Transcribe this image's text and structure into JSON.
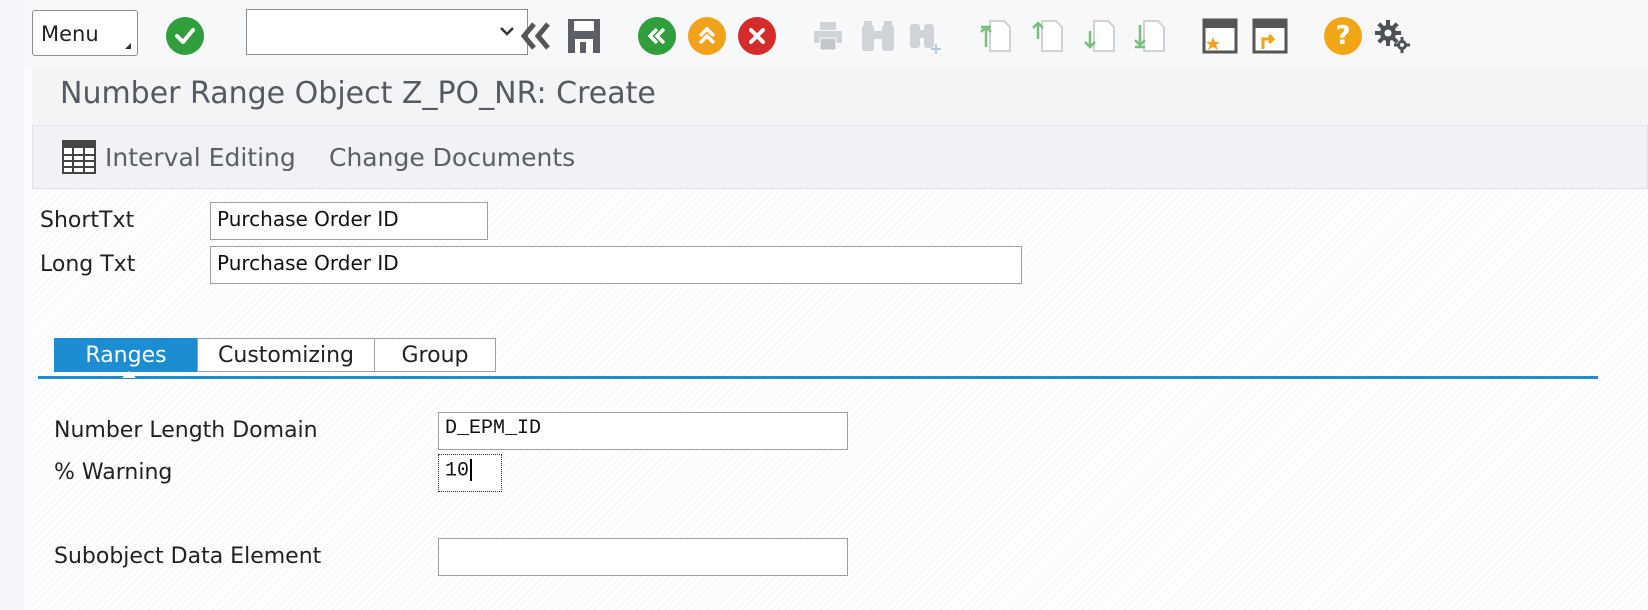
{
  "toolbar": {
    "menu_label": "Menu",
    "command_placeholder": "",
    "icons": [
      "check-icon",
      "back-double-icon",
      "save-icon",
      "back-icon",
      "exit-icon",
      "cancel-icon",
      "print-icon",
      "find-icon",
      "find-next-icon",
      "first-page-icon",
      "previous-page-icon",
      "next-page-icon",
      "last-page-icon",
      "create-session-icon",
      "generate-shortcut-icon",
      "help-icon",
      "settings-icon"
    ],
    "help_glyph": "?"
  },
  "title": "Number Range Object Z_PO_NR: Create",
  "app_toolbar": {
    "interval_editing": "Interval Editing",
    "change_documents": "Change Documents"
  },
  "form": {
    "short_txt_label": "ShortTxt",
    "short_txt_value": "Purchase Order ID",
    "long_txt_label": "Long Txt",
    "long_txt_value": "Purchase Order ID"
  },
  "tabs": [
    {
      "label": "Ranges",
      "active": true
    },
    {
      "label": "Customizing",
      "active": false
    },
    {
      "label": "Group",
      "active": false
    }
  ],
  "ranges": {
    "domain_label": "Number Length Domain",
    "domain_value": "D_EPM_ID",
    "warning_label": "% Warning",
    "warning_value": "10",
    "subobject_label": "Subobject Data Element",
    "subobject_value": ""
  },
  "colors": {
    "accent": "#1c8dd1",
    "ok_green": "#2f9e3b",
    "cancel_red": "#d42b2b",
    "nav_orange": "#f0a21b"
  }
}
